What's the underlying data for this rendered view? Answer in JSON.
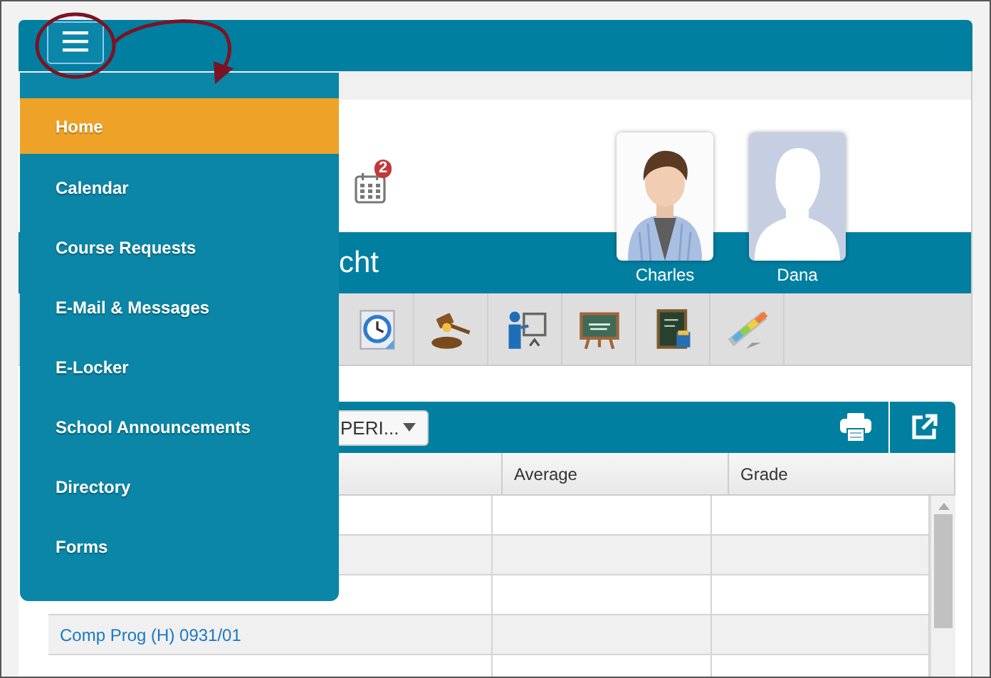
{
  "menu": {
    "items": [
      {
        "label": "Home",
        "selected": true
      },
      {
        "label": "Calendar",
        "selected": false
      },
      {
        "label": "Course Requests",
        "selected": false
      },
      {
        "label": "E-Mail & Messages",
        "selected": false
      },
      {
        "label": "E-Locker",
        "selected": false
      },
      {
        "label": "School Announcements",
        "selected": false
      },
      {
        "label": "Directory",
        "selected": false
      },
      {
        "label": "Forms",
        "selected": false
      }
    ]
  },
  "notifications": [
    {
      "kind": "calendar",
      "badge": "2"
    }
  ],
  "student": {
    "name": "cht"
  },
  "siblings": [
    {
      "name": "Charles",
      "kind": "picture"
    },
    {
      "name": "Dana",
      "kind": "silhouette"
    }
  ],
  "toolbar": [
    {
      "kind": "clock"
    },
    {
      "kind": "gavel"
    },
    {
      "kind": "presenter"
    },
    {
      "kind": "chalkboard"
    },
    {
      "kind": "blackboard"
    },
    {
      "kind": "chart"
    }
  ],
  "grades": {
    "filter": "PERI...",
    "columns": [
      "Average",
      "Grade"
    ],
    "rows": [
      {},
      {},
      {},
      {
        "subject": "Comp Prog (H) 0931/01"
      },
      {}
    ]
  }
}
